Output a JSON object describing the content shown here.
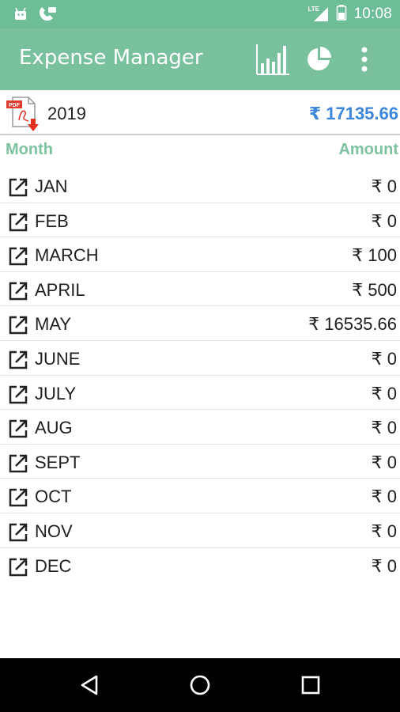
{
  "status_bar": {
    "network_label": "LTE",
    "time": "10:08",
    "icons": [
      "android-icon",
      "phone-call-icon",
      "signal-icon",
      "battery-icon"
    ]
  },
  "app_bar": {
    "title": "Expense Manager",
    "actions": [
      "bar-chart-icon",
      "pie-chart-icon",
      "overflow-menu-icon"
    ],
    "color": "#79c19d"
  },
  "summary": {
    "year": "2019",
    "total": "₹ 17135.66",
    "total_color": "#3d86d9",
    "pdf_icon_label": "PDF"
  },
  "list": {
    "header_month": "Month",
    "header_amount": "Amount",
    "header_color": "#7dc3a0",
    "rows": [
      {
        "month": "JAN",
        "amount": "₹ 0"
      },
      {
        "month": "FEB",
        "amount": "₹ 0"
      },
      {
        "month": "MARCH",
        "amount": "₹ 100"
      },
      {
        "month": "APRIL",
        "amount": "₹ 500"
      },
      {
        "month": "MAY",
        "amount": "₹ 16535.66"
      },
      {
        "month": "JUNE",
        "amount": "₹ 0"
      },
      {
        "month": "JULY",
        "amount": "₹ 0"
      },
      {
        "month": "AUG",
        "amount": "₹ 0"
      },
      {
        "month": "SEPT",
        "amount": "₹ 0"
      },
      {
        "month": "OCT",
        "amount": "₹ 0"
      },
      {
        "month": "NOV",
        "amount": "₹ 0"
      },
      {
        "month": "DEC",
        "amount": "₹ 0"
      }
    ]
  },
  "nav_bar": {
    "buttons": [
      "back-icon",
      "home-icon",
      "recents-icon"
    ]
  }
}
